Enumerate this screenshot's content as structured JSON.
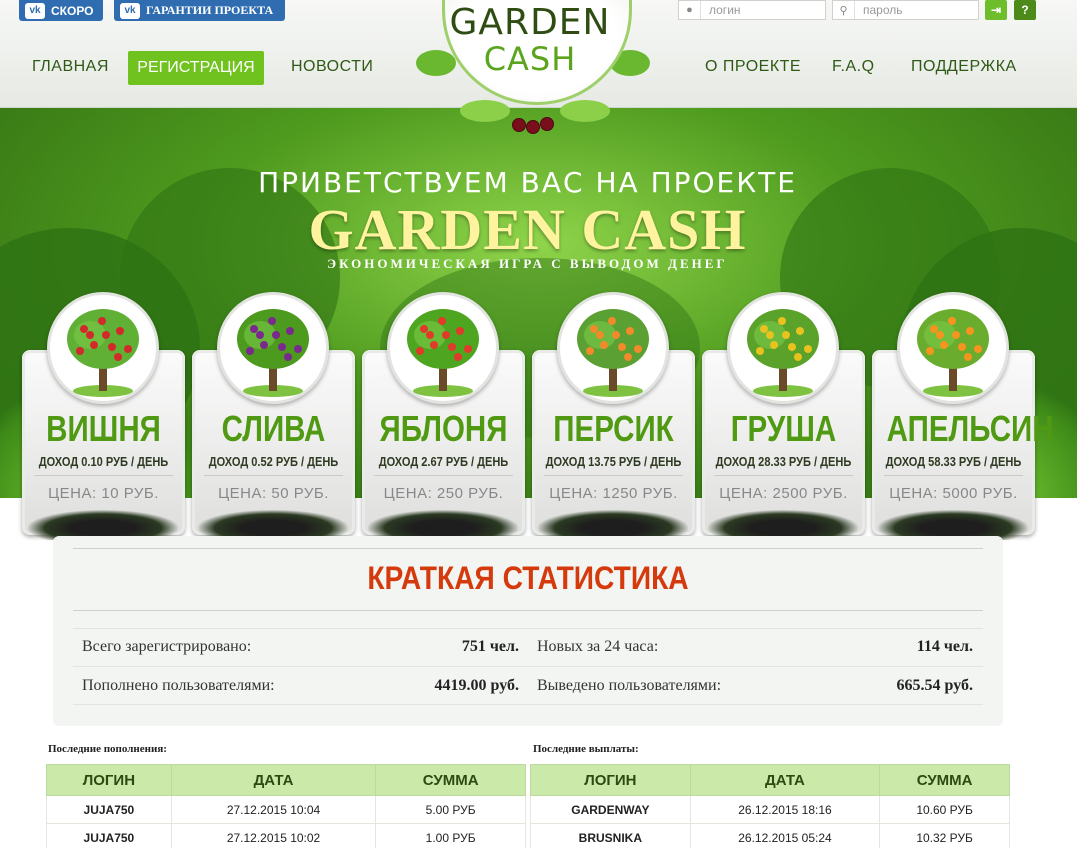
{
  "header": {
    "vk_soon": "СКОРО",
    "vk_guarantee": "ГАРАНТИИ ПРОЕКТА",
    "login_placeholder": "логин",
    "password_placeholder": "пароль",
    "login_button": "⇥",
    "help_button": "?",
    "logo_line1": "GARDEN",
    "logo_line2": "CASH"
  },
  "nav": {
    "home": "ГЛАВНАЯ",
    "register": "РЕГИСТРАЦИЯ",
    "news": "НОВОСТИ",
    "about": "О ПРОЕКТЕ",
    "faq": "F.A.Q",
    "support": "ПОДДЕРЖКА"
  },
  "hero": {
    "welcome": "ПРИВЕТСТВУЕМ ВАС НА ПРОЕКТЕ",
    "title": "GARDEN CASH",
    "subtitle": "ЭКОНОМИЧЕСКАЯ ИГРА С ВЫВОДОМ ДЕНЕГ"
  },
  "trees": [
    {
      "name": "ВИШНЯ",
      "income": "ДОХОД 0.10 РУБ / ДЕНЬ",
      "price": "ЦЕНА: 10 РУБ.",
      "fruit_color": "#d22a2a",
      "leaf_color": "#5fb035"
    },
    {
      "name": "СЛИВА",
      "income": "ДОХОД 0.52 РУБ / ДЕНЬ",
      "price": "ЦЕНА: 50 РУБ.",
      "fruit_color": "#7a2a8c",
      "leaf_color": "#4c9a1e"
    },
    {
      "name": "ЯБЛОНЯ",
      "income": "ДОХОД 2.67 РУБ / ДЕНЬ",
      "price": "ЦЕНА: 250 РУБ.",
      "fruit_color": "#e03a2a",
      "leaf_color": "#4ea620"
    },
    {
      "name": "ПЕРСИК",
      "income": "ДОХОД 13.75 РУБ / ДЕНЬ",
      "price": "ЦЕНА: 1250 РУБ.",
      "fruit_color": "#f08a2a",
      "leaf_color": "#5aa032"
    },
    {
      "name": "ГРУША",
      "income": "ДОХОД 28.33 РУБ / ДЕНЬ",
      "price": "ЦЕНА: 2500 РУБ.",
      "fruit_color": "#e8c21e",
      "leaf_color": "#5aa22a"
    },
    {
      "name": "АПЕЛЬСИН",
      "income": "ДОХОД 58.33 РУБ / ДЕНЬ",
      "price": "ЦЕНА: 5000 РУБ.",
      "fruit_color": "#f5941e",
      "leaf_color": "#6aad2e"
    }
  ],
  "stats": {
    "title": "КРАТКАЯ СТАТИСТИКА",
    "registered_label": "Всего зарегистрировано:",
    "registered_value": "751 чел.",
    "new24_label": "Новых за 24 часа:",
    "new24_value": "114 чел.",
    "deposited_label": "Пополнено пользователями:",
    "deposited_value": "4419.00 руб.",
    "withdrawn_label": "Выведено пользователями:",
    "withdrawn_value": "665.54 руб."
  },
  "deposits": {
    "caption": "Последние пополнения:",
    "headers": [
      "ЛОГИН",
      "ДАТА",
      "СУММА"
    ],
    "rows": [
      [
        "JUJA750",
        "27.12.2015 10:04",
        "5.00 РУБ"
      ],
      [
        "JUJA750",
        "27.12.2015 10:02",
        "1.00 РУБ"
      ]
    ]
  },
  "payouts": {
    "caption": "Последние выплаты:",
    "headers": [
      "ЛОГИН",
      "ДАТА",
      "СУММА"
    ],
    "rows": [
      [
        "GARDENWAY",
        "26.12.2015 18:16",
        "10.60 РУБ"
      ],
      [
        "BRUSNIKA",
        "26.12.2015 05:24",
        "10.32 РУБ"
      ]
    ]
  }
}
